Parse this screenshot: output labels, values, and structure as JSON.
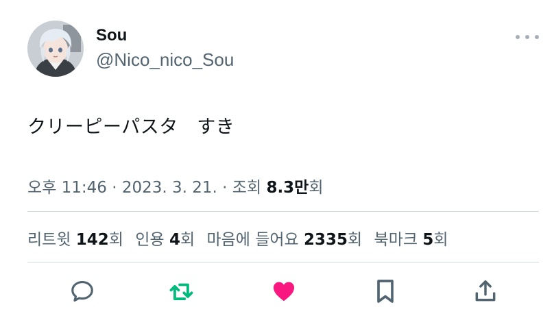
{
  "author": {
    "name": "Sou",
    "handle": "@Nico_nico_Sou"
  },
  "tweet": {
    "text": "クリーピーパスタ　すき"
  },
  "meta": {
    "time": "오후 11:46",
    "sep1": " · ",
    "date": "2023. 3. 21.",
    "sep2": " · ",
    "views_label": "조회 ",
    "views_value": "8.3만",
    "views_suffix": "회"
  },
  "stats": {
    "retweets_label": "리트윗 ",
    "retweets_value": "142",
    "retweets_suffix": "회",
    "quotes_label": "인용 ",
    "quotes_value": "4",
    "quotes_suffix": "회",
    "likes_label": "마음에 들어요 ",
    "likes_value": "2335",
    "likes_suffix": "회",
    "bookmarks_label": "북마크 ",
    "bookmarks_value": "5",
    "bookmarks_suffix": "회"
  },
  "actions": [
    "reply-icon",
    "retweet-icon",
    "like-icon",
    "bookmark-icon",
    "share-icon"
  ],
  "colors": {
    "text": "#0f1419",
    "secondary": "#536471",
    "divider": "#cfd9de",
    "icon": "#536471",
    "retweet_active": "#00ba7c",
    "like_active": "#f91880"
  }
}
